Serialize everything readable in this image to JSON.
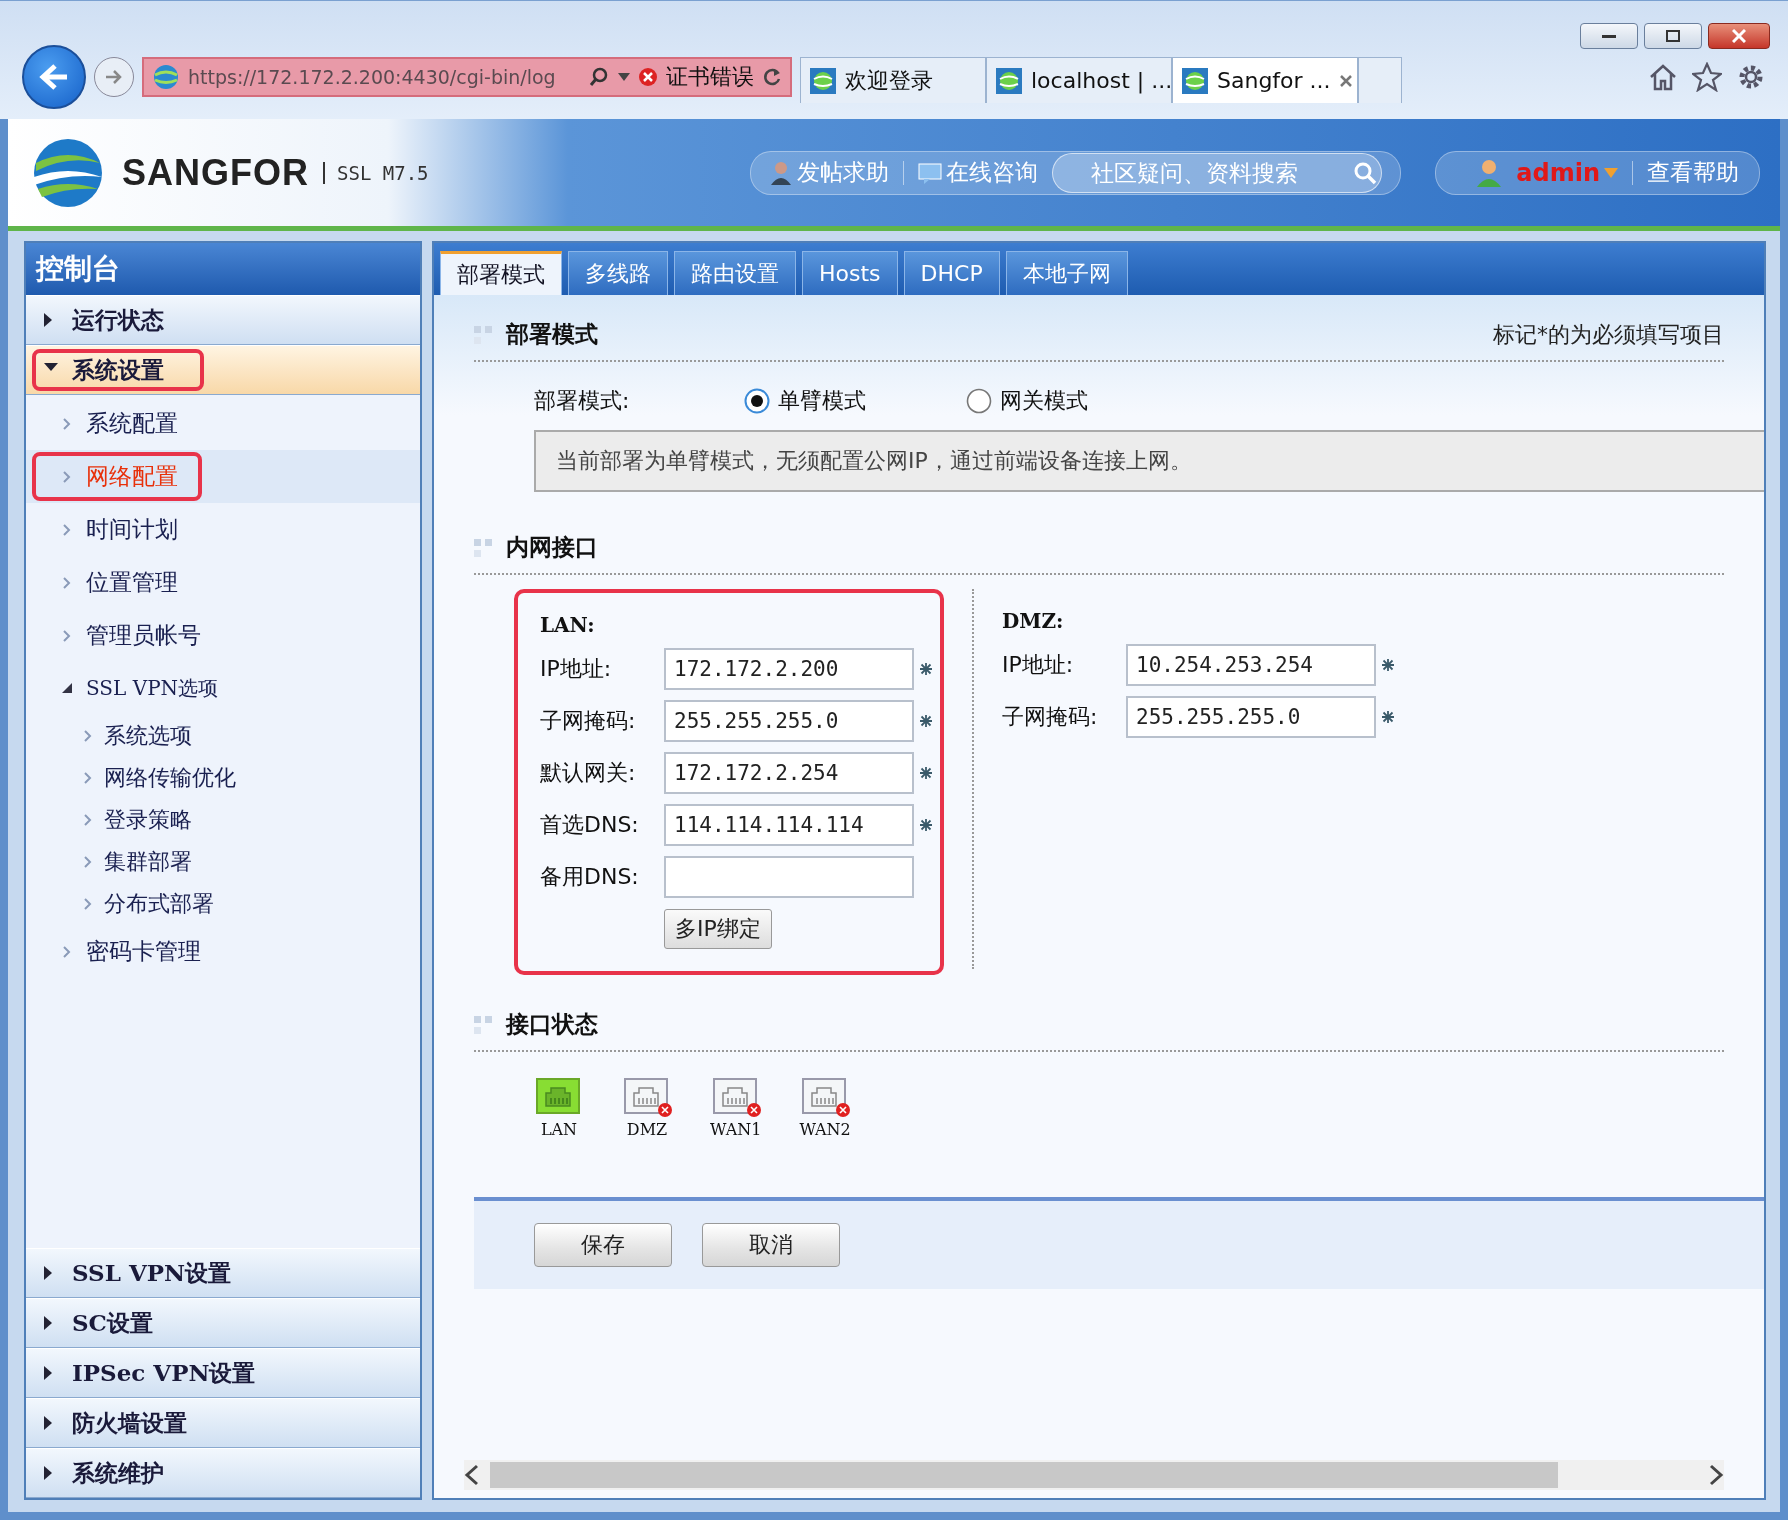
{
  "browser": {
    "url": "https://172.172.2.200:4430/cgi-bin/log",
    "cert_error": "证书错误",
    "tabs": [
      {
        "title": "欢迎登录",
        "selected": false
      },
      {
        "title": "localhost | ...",
        "selected": false
      },
      {
        "title": "Sangfor ...",
        "selected": true
      }
    ]
  },
  "header": {
    "brand": "SANGFOR",
    "version": "SSL M7.5",
    "links": [
      "发帖求助",
      "在线咨询"
    ],
    "search": {
      "placeholder": "社区疑问、资料搜索"
    },
    "user": "admin",
    "help": "查看帮助"
  },
  "sidebar": {
    "title": "控制台",
    "groups": [
      {
        "label": "运行状态",
        "expanded": false,
        "highlighted": false
      },
      {
        "label": "系统设置",
        "expanded": true,
        "highlighted": true,
        "items": [
          {
            "label": "系统配置",
            "selected": false,
            "highlighted": false
          },
          {
            "label": "网络配置",
            "selected": true,
            "highlighted": true
          },
          {
            "label": "时间计划",
            "selected": false,
            "highlighted": false
          },
          {
            "label": "位置管理",
            "selected": false,
            "highlighted": false
          },
          {
            "label": "管理员帐号",
            "selected": false,
            "highlighted": false
          },
          {
            "label": "SSL VPN选项",
            "selected": false,
            "highlighted": false,
            "expanded": true,
            "children": [
              {
                "label": "系统选项",
                "selected": false
              },
              {
                "label": "网络传输优化",
                "selected": false
              },
              {
                "label": "登录策略",
                "selected": false
              },
              {
                "label": "集群部署",
                "selected": false
              },
              {
                "label": "分布式部署",
                "selected": false
              }
            ]
          },
          {
            "label": "密码卡管理",
            "selected": false,
            "highlighted": false
          }
        ]
      },
      {
        "label": "SSL VPN设置",
        "expanded": false,
        "highlighted": false
      },
      {
        "label": "SC设置",
        "expanded": false,
        "highlighted": false
      },
      {
        "label": "IPSec VPN设置",
        "expanded": false,
        "highlighted": false
      },
      {
        "label": "防火墙设置",
        "expanded": false,
        "highlighted": false
      },
      {
        "label": "系统维护",
        "expanded": false,
        "highlighted": false
      }
    ]
  },
  "tabs": [
    {
      "label": "部署模式",
      "selected": true
    },
    {
      "label": "多线路",
      "selected": false
    },
    {
      "label": "路由设置",
      "selected": false
    },
    {
      "label": "Hosts",
      "selected": false
    },
    {
      "label": "DHCP",
      "selected": false
    },
    {
      "label": "本地子网",
      "selected": false
    }
  ],
  "deploy": {
    "title": "部署模式",
    "note": "标记*的为必须填写项目",
    "label": "部署模式:",
    "options": [
      {
        "label": "单臂模式",
        "selected": true
      },
      {
        "label": "网关模式",
        "selected": false
      }
    ],
    "info": "当前部署为单臂模式，无须配置公网IP，通过前端设备连接上网。"
  },
  "interfaces": {
    "title": "内网接口",
    "lan": {
      "title": "LAN:",
      "highlighted": true,
      "fields": [
        {
          "label": "IP地址:",
          "value": "172.172.2.200",
          "required": true
        },
        {
          "label": "子网掩码:",
          "value": "255.255.255.0",
          "required": true
        },
        {
          "label": "默认网关:",
          "value": "172.172.2.254",
          "required": true
        },
        {
          "label": "首选DNS:",
          "value": "114.114.114.114",
          "required": true
        },
        {
          "label": "备用DNS:",
          "required": false
        }
      ],
      "button": "多IP绑定"
    },
    "dmz": {
      "title": "DMZ:",
      "fields": [
        {
          "label": "IP地址:",
          "value": "10.254.253.254",
          "required": true
        },
        {
          "label": "子网掩码:",
          "value": "255.255.255.0",
          "required": true
        }
      ]
    }
  },
  "status": {
    "title": "接口状态",
    "ports": [
      {
        "label": "LAN",
        "connected": true
      },
      {
        "label": "DMZ",
        "connected": false
      },
      {
        "label": "WAN1",
        "connected": false
      },
      {
        "label": "WAN2",
        "connected": false
      }
    ]
  },
  "buttons": [
    "保存",
    "取消"
  ]
}
